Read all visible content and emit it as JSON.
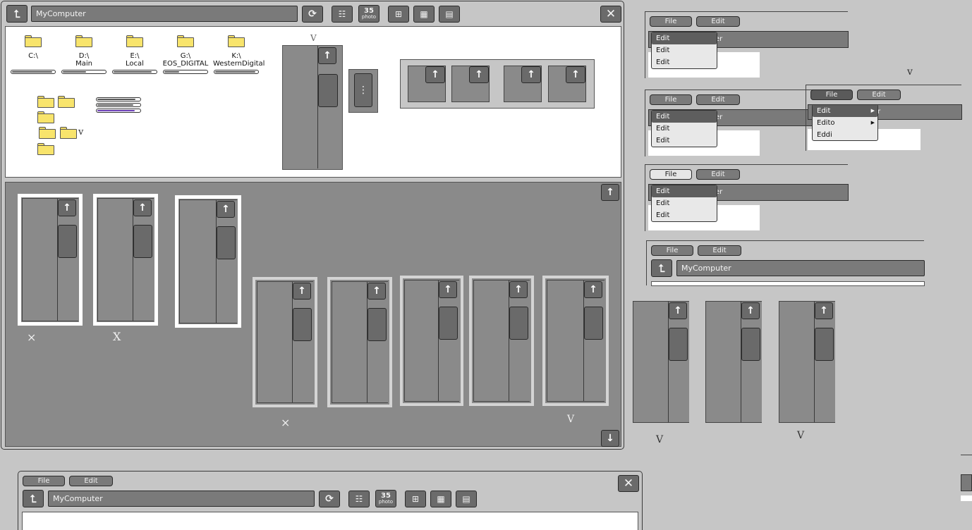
{
  "main_window": {
    "address": "MyComputer",
    "photo_label_top": "35",
    "photo_label_bottom": "photo",
    "drives": [
      {
        "name": "C:\\",
        "sub": "",
        "fill": 0.95
      },
      {
        "name": "D:\\",
        "sub": "Main",
        "fill": 0.55
      },
      {
        "name": "E:\\",
        "sub": "Local",
        "fill": 0.9
      },
      {
        "name": "G:\\",
        "sub": "EOS_DIGITAL",
        "fill": 0.35
      },
      {
        "name": "K:\\",
        "sub": "WesternDigital",
        "fill": 0.95
      }
    ],
    "progress_bars": [
      {
        "fill": 0.9,
        "color": "#555555"
      },
      {
        "fill": 0.85,
        "color": "#555555"
      },
      {
        "fill": 0.88,
        "color": "#6a3fb5"
      }
    ],
    "scribbles": {
      "top_v": "V",
      "folder_v": "v"
    }
  },
  "lower_scribbles": {
    "x1": "×",
    "x2": "X",
    "x3": "×",
    "v1": "V"
  },
  "menu_windows": [
    {
      "file": "File",
      "edit": "Edit",
      "items": [
        "Edit",
        "Edit",
        "Edit"
      ],
      "bg_text": "er"
    },
    {
      "file": "File",
      "edit": "Edit",
      "items": [
        "Edit",
        "Edit",
        "Edit"
      ],
      "bg_text": "er"
    },
    {
      "file": "File",
      "edit": "Edit",
      "items": [
        "Edit",
        "Edit",
        "Edit"
      ],
      "bg_text": "er"
    }
  ],
  "sub_menu_window": {
    "file": "File",
    "edit": "Edit",
    "items": [
      "Edit",
      "Edito",
      "Eddi"
    ],
    "bg_text": "er",
    "scribble": "v"
  },
  "small_window": {
    "file": "File",
    "edit": "Edit",
    "address": "MyComputer"
  },
  "right_scribbles": {
    "v1": "V",
    "v2": "V"
  },
  "bottom_window": {
    "file": "File",
    "edit": "Edit",
    "address": "MyComputer",
    "photo_label_top": "35",
    "photo_label_bottom": "photo"
  }
}
